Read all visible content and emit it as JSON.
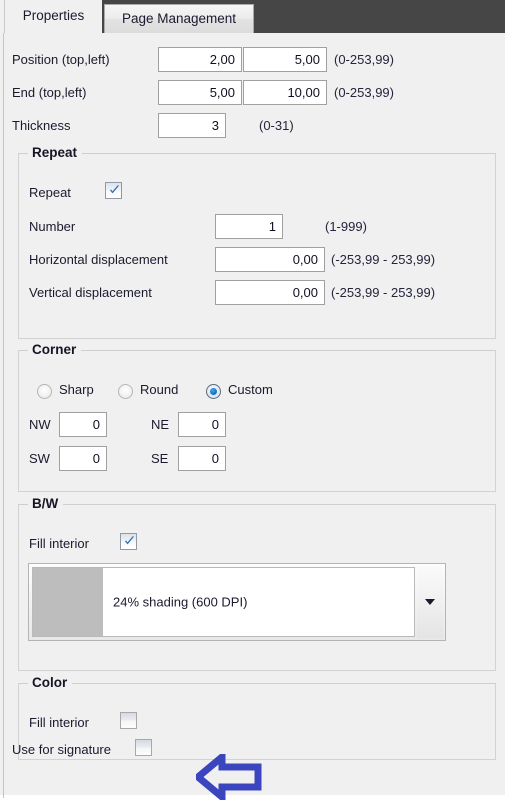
{
  "window": {
    "background_color": "#f0f0f0",
    "tabstrip_color": "#464646"
  },
  "tabs": [
    {
      "label": "Properties",
      "active": true
    },
    {
      "label": "Page Management",
      "active": false
    }
  ],
  "main": {
    "fields": [
      {
        "label": "Position (top,left)",
        "value1": "2,00",
        "value2": "5,00",
        "range": "(0-253,99)"
      },
      {
        "label": "End (top,left)",
        "value1": "5,00",
        "value2": "10,00",
        "range": "(0-253,99)"
      },
      {
        "label": "Thickness",
        "value1": "3",
        "range": "(0-31)"
      }
    ]
  },
  "repeat_group": {
    "title": "Repeat",
    "checkbox_label": "Repeat",
    "checkbox_checked": true,
    "rows": [
      {
        "label": "Number",
        "value": "1",
        "range": "(1-999)"
      },
      {
        "label": "Horizontal displacement",
        "value": "0,00",
        "range": "(-253,99 - 253,99)"
      },
      {
        "label": "Vertical displacement",
        "value": "0,00",
        "range": "(-253,99 - 253,99)"
      }
    ]
  },
  "corner_group": {
    "title": "Corner",
    "options": [
      {
        "label": "Sharp",
        "selected": false
      },
      {
        "label": "Round",
        "selected": false
      },
      {
        "label": "Custom",
        "selected": true
      }
    ],
    "corners": [
      {
        "label": "NW",
        "value": "0"
      },
      {
        "label": "NE",
        "value": "0"
      },
      {
        "label": "SW",
        "value": "0"
      },
      {
        "label": "SE",
        "value": "0"
      }
    ]
  },
  "bw_group": {
    "title": "B/W",
    "fill_label": "Fill interior",
    "fill_checked": true,
    "shading": {
      "selected": "24% shading (600 DPI)",
      "swatch_color": "#bdbdbd",
      "caret_icon": "chevron-down-icon"
    }
  },
  "color_group": {
    "title": "Color",
    "fill_label": "Fill interior",
    "fill_checked": false
  },
  "signature": {
    "label": "Use for signature",
    "checked": false
  },
  "annotation": {
    "icon": "arrow-left-callout-icon",
    "color": "#3b45bd"
  }
}
